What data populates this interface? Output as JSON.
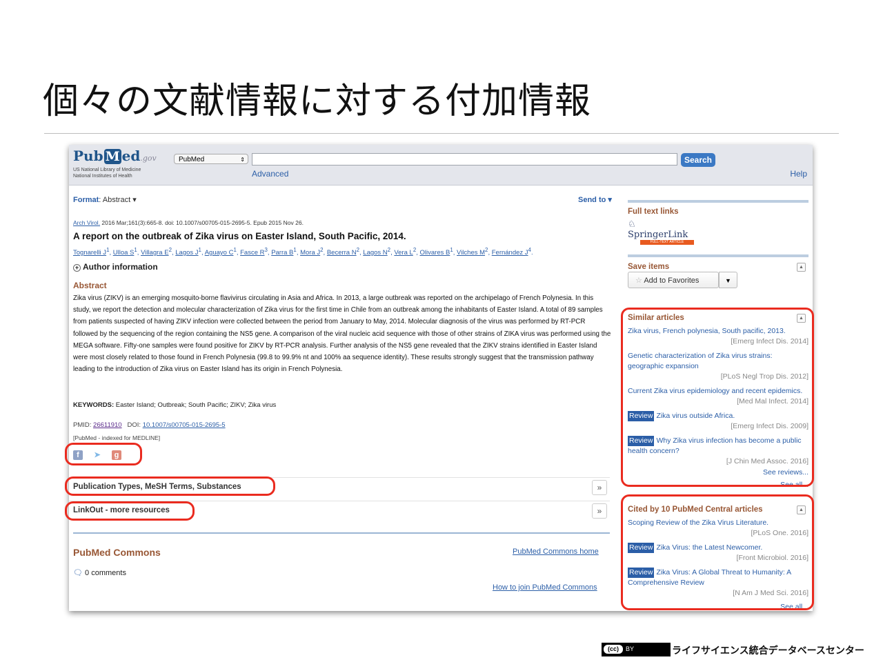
{
  "slide": {
    "title": "個々の文献情報に対する付加情報",
    "footer": "ライフサイエンス統合データベースセンター",
    "cc_label": "(cc)",
    "by_label": "BY"
  },
  "header": {
    "logo_pub": "Pub",
    "logo_m": "M",
    "logo_ed": "ed",
    "logo_gov": ".gov",
    "org_line1": "US National Library of Medicine",
    "org_line2": "National Institutes of Health",
    "database_select": "PubMed",
    "search_value": "",
    "search_button": "Search",
    "advanced_link": "Advanced",
    "help_link": "Help"
  },
  "article": {
    "format_label": "Format",
    "format_value": ": Abstract ▾",
    "send_to": "Send to ▾",
    "journal": "Arch Virol.",
    "citation": " 2016 Mar;161(3):665-8. doi: 10.1007/s00705-015-2695-5. Epub 2015 Nov 26.",
    "title": "A report on the outbreak of Zika virus on Easter Island, South Pacific, 2014.",
    "authors": [
      "Tognarelli J",
      "Ulloa S",
      "Villagra E",
      "Lagos J",
      "Aguayo C",
      "Fasce R",
      "Parra B",
      "Mora J",
      "Becerra N",
      "Lagos N",
      "Vera L",
      "Olivares B",
      "Vilches M",
      "Fernández J"
    ],
    "affiliations": [
      "1",
      "1",
      "2",
      "1",
      "1",
      "3",
      "1",
      "2",
      "2",
      "2",
      "2",
      "1",
      "2",
      "4"
    ],
    "author_info": "Author information",
    "abstract_heading": "Abstract",
    "abstract": "Zika virus (ZIKV) is an emerging mosquito-borne flavivirus circulating in Asia and Africa. In 2013, a large outbreak was reported on the archipelago of French Polynesia. In this study, we report the detection and molecular characterization of Zika virus for the first time in Chile from an outbreak among the inhabitants of Easter Island. A total of 89 samples from patients suspected of having ZIKV infection were collected between the period from January to May, 2014. Molecular diagnosis of the virus was performed by RT-PCR followed by the sequencing of the region containing the NS5 gene. A comparison of the viral nucleic acid sequence with those of other strains of ZIKA virus was performed using the MEGA software. Fifty-one samples were found positive for ZIKV by RT-PCR analysis. Further analysis of the NS5 gene revealed that the ZIKV strains identified in Easter Island were most closely related to those found in French Polynesia (99.8 to 99.9% nt and 100% aa sequence identity). These results strongly suggest that the transmission pathway leading to the introduction of Zika virus on Easter Island has its origin in French Polynesia.",
    "keywords_label": "KEYWORDS:",
    "keywords": " Easter Island; Outbreak; South Pacific; ZIKV; Zika virus",
    "pmid_label": "PMID: ",
    "pmid": "26611910",
    "doi_label": "DOI: ",
    "doi": "10.1007/s00705-015-2695-5",
    "indexed": "[PubMed - indexed for MEDLINE]",
    "accordion1": "Publication Types, MeSH Terms, Substances",
    "accordion2": "LinkOut - more resources",
    "commons_heading": "PubMed Commons",
    "commons_home": "PubMed Commons home",
    "comments": "0 comments",
    "how_to_join": "How to join PubMed Commons"
  },
  "sidebar": {
    "fulltext_heading": "Full text links",
    "springer_name": "SpringerLink",
    "springer_tag": "FULL-TEXT ARTICLE",
    "save_heading": "Save items",
    "add_favorites": "Add to Favorites",
    "similar_heading": "Similar articles",
    "similar": [
      {
        "review": "",
        "title": "Zika virus, French polynesia, South pacific, 2013.",
        "source": "[Emerg Infect Dis. 2014]"
      },
      {
        "review": "",
        "title": "Genetic characterization of Zika virus strains: geographic expansion",
        "source": "[PLoS Negl Trop Dis. 2012]"
      },
      {
        "review": "",
        "title": "Current Zika virus epidemiology and recent epidemics.",
        "source": "[Med Mal Infect. 2014]"
      },
      {
        "review": "Review",
        "title": "Zika virus outside Africa.",
        "source": "[Emerg Infect Dis. 2009]"
      },
      {
        "review": "Review",
        "title": "Why Zika virus infection has become a public health concern?",
        "source": "[J Chin Med Assoc. 2016]"
      }
    ],
    "see_reviews": "See reviews...",
    "see_all": "See all...",
    "cited_heading": "Cited by 10 PubMed Central articles",
    "cited": [
      {
        "review": "",
        "title": "Scoping Review of the Zika Virus Literature.",
        "source": "[PLoS One. 2016]"
      },
      {
        "review": "Review",
        "title": "Zika Virus: the Latest Newcomer.",
        "source": "[Front Microbiol. 2016]"
      },
      {
        "review": "Review",
        "title": "Zika Virus: A Global Threat to Humanity: A Comprehensive Review",
        "source": "[N Am J Med Sci. 2016]"
      }
    ],
    "cited_see_all": "See all..."
  },
  "colors": {
    "highlight": "#ea2b1f",
    "link": "#2b5ea7",
    "heading": "#985735"
  }
}
